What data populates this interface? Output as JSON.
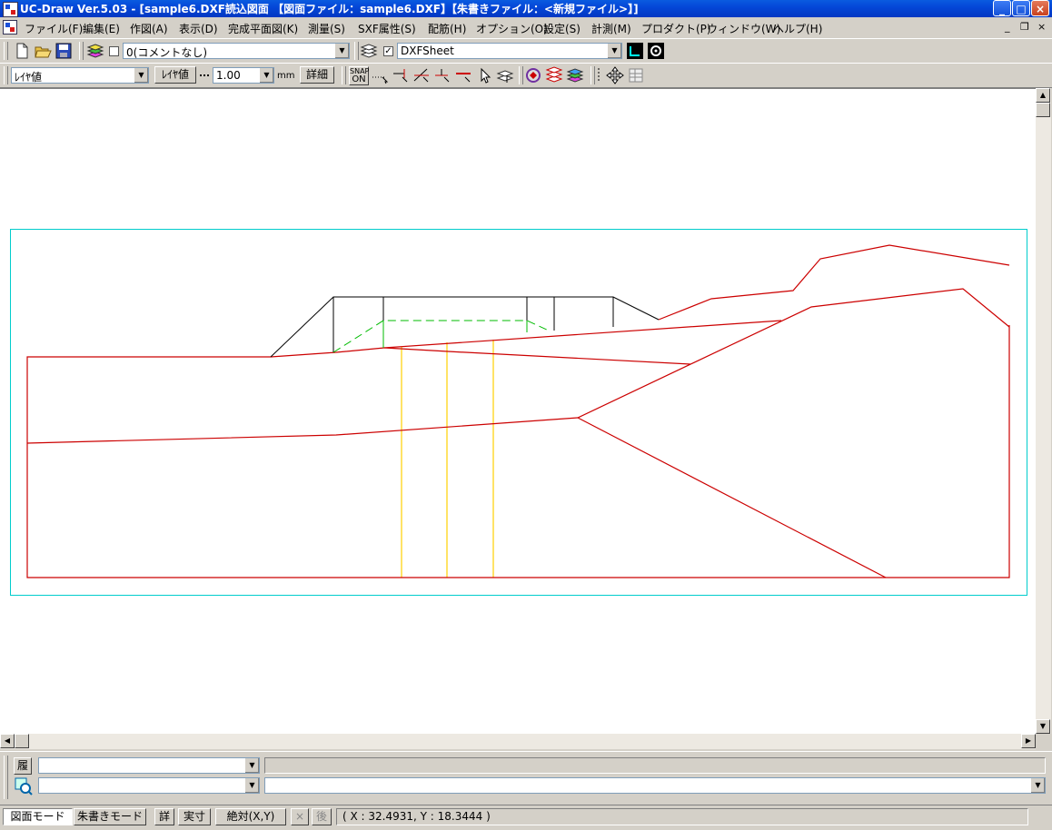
{
  "window": {
    "title": "UC-Draw Ver.5.03 - [sample6.DXF読込図面 【図面ファイル：sample6.DXF】【朱書きファイル：<新規ファイル>】]"
  },
  "menu": [
    "ファイル(F)",
    "編集(E)",
    "作図(A)",
    "表示(D)",
    "完成平面図(K)",
    "測量(S)",
    "SXF属性(S)",
    "配筋(H)",
    "オプション(O)",
    "設定(S)",
    "計測(M)",
    "プロダクト(P)",
    "ウィンドウ(W)",
    "ヘルプ(H)"
  ],
  "toolbar1": {
    "comment_combo": "0(コメントなし)",
    "sheet_combo": "DXFSheet"
  },
  "toolbar2": {
    "layer_combo": "ﾚｲﾔ値",
    "layer_btn": "ﾚｲﾔ値",
    "line_width": "1.00",
    "unit": "mm",
    "detail_btn": "詳細",
    "snap_top": "SNAP",
    "snap_bottom": "ON"
  },
  "cmd": {
    "history_btn": "履"
  },
  "status": {
    "mode_drawing": "図面モード",
    "mode_redline": "朱書きモード",
    "detail": "詳",
    "actual": "実寸",
    "absolute": "絶対(X,Y)",
    "back": "後",
    "coords": "( X : 32.4931, Y : 18.3444 )"
  },
  "colors": {
    "profile": "#cc0000",
    "structure": "#000000",
    "dashed": "#00bb00",
    "piles": "#ffd000",
    "frame": "#00cccc"
  }
}
